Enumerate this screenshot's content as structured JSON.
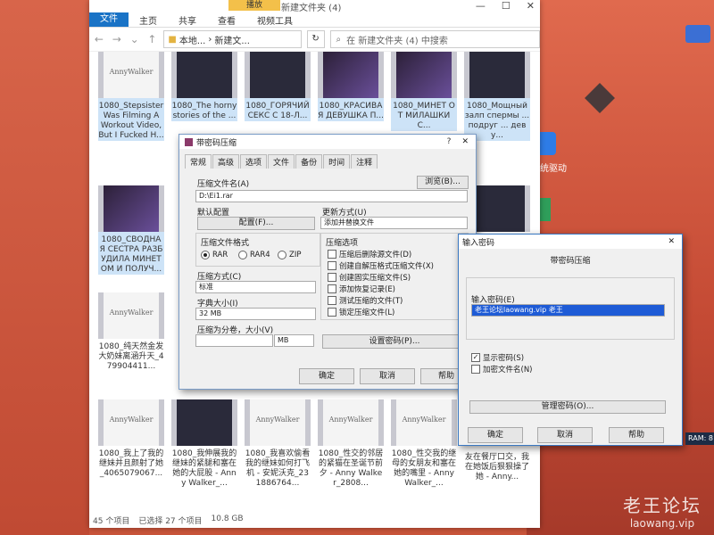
{
  "window": {
    "title": "新建文件夹 (4)",
    "context_tab": "播放",
    "ribbon": [
      "文件",
      "主页",
      "共享",
      "查看",
      "视频工具"
    ],
    "address": {
      "path_prefix": "本地...",
      "path_current": "新建文...",
      "search_placeholder": "在 新建文件夹 (4) 中搜索"
    },
    "status": {
      "count": "45 个项目",
      "selected": "已选择 27 个项目",
      "size": "10.8 GB"
    }
  },
  "files": [
    {
      "caption": "1080_Stepsister Was Filming A Workout Video, But I Fucked H...",
      "thumb": "AnnyWalker",
      "style": "light"
    },
    {
      "caption": "1080_The horny stories of the ...",
      "thumb": "",
      "style": "dark"
    },
    {
      "caption": "1080_ГОРЯЧИЙ СЕКС С 18-Л...",
      "thumb": "",
      "style": "dark"
    },
    {
      "caption": "1080_КРАСИВАЯ ДЕВУШКА П...",
      "thumb": "",
      "style": "purple"
    },
    {
      "caption": "1080_МИНЕТ О Т МИЛАШКИ С...",
      "thumb": "",
      "style": "purple"
    },
    {
      "caption": "1080_Мощный залп спермы ... подруг ... деву...",
      "thumb": "",
      "style": "dark"
    },
    {
      "caption": "1080_СВОДНА Я СЕСТРА РАЗБ УДИЛА МИНЕТ ОМ И ПОЛУЧ...",
      "thumb": "",
      "style": "purple"
    },
    {
      "caption": "1080_纯天然金发大奶妹离涵升天_479904411...",
      "thumb": "AnnyWalker",
      "style": "light"
    },
    {
      "caption": "1080_我上了我的继妹并且颜射了她_4065079067...",
      "thumb": "AnnyWalker",
      "style": "light"
    },
    {
      "caption": "1080_我伸展我的继妹的紧腿和塞在她的大屁股 - Anny Walker_...",
      "thumb": "",
      "style": "dark"
    },
    {
      "caption": "1080_我喜欢偷看我的继妹如何打飞机 - 安妮沃克_231886764...",
      "thumb": "AnnyWalker",
      "style": "light"
    },
    {
      "caption": "1080_性交的邻居的紧猫在圣诞节前夕 - Anny Walker_2808...",
      "thumb": "AnnyWalker",
      "style": "light"
    },
    {
      "caption": "1080_性交我的继母的女朋友和塞在她的嘴里 - Anny Walker_...",
      "thumb": "AnnyWalker",
      "style": "light"
    },
    {
      "caption": "友在餐厅口交，我在她饭后狠狠操了她 - Anny...",
      "thumb": "",
      "style": "light"
    }
  ],
  "compress_dialog": {
    "title": "带密码压缩",
    "close": "?",
    "tabs": [
      "常规",
      "高级",
      "选项",
      "文件",
      "备份",
      "时间",
      "注释"
    ],
    "archive_name_label": "压缩文件名(A)",
    "archive_name_value": "D:\\Ei1.rar",
    "browse": "浏览(B)...",
    "profile_label": "默认配置",
    "profile_button": "配置(F)...",
    "update_label": "更新方式(U)",
    "update_value": "添加并替换文件",
    "format_label": "压缩文件格式",
    "formats": [
      "RAR",
      "RAR4",
      "ZIP"
    ],
    "method_label": "压缩方式(C)",
    "method_value": "标准",
    "dict_label": "字典大小(I)",
    "dict_value": "32 MB",
    "split_label": "压缩为分卷，大小(V)",
    "split_unit": "MB",
    "options_label": "压缩选项",
    "options": [
      "压缩后删除源文件(D)",
      "创建自解压格式压缩文件(X)",
      "创建固实压缩文件(S)",
      "添加恢复记录(E)",
      "测试压缩的文件(T)",
      "锁定压缩文件(L)"
    ],
    "set_password": "设置密码(P)...",
    "ok": "确定",
    "cancel": "取消",
    "help": "帮助"
  },
  "password_dialog": {
    "title": "输入密码",
    "heading": "带密码压缩",
    "enter_label": "输入密码(E)",
    "password_value": "老王论坛laowang.vip 老王",
    "show_password": "显示密码(S)",
    "encrypt_names": "加密文件名(N)",
    "manage": "管理密码(O)...",
    "ok": "确定",
    "cancel": "取消",
    "help": "帮助"
  },
  "desktop": {
    "icon_label": "系统驱动",
    "ram": "RAM: 8"
  },
  "watermark": {
    "line1": "老王论坛",
    "line2": "laowang.vip"
  }
}
